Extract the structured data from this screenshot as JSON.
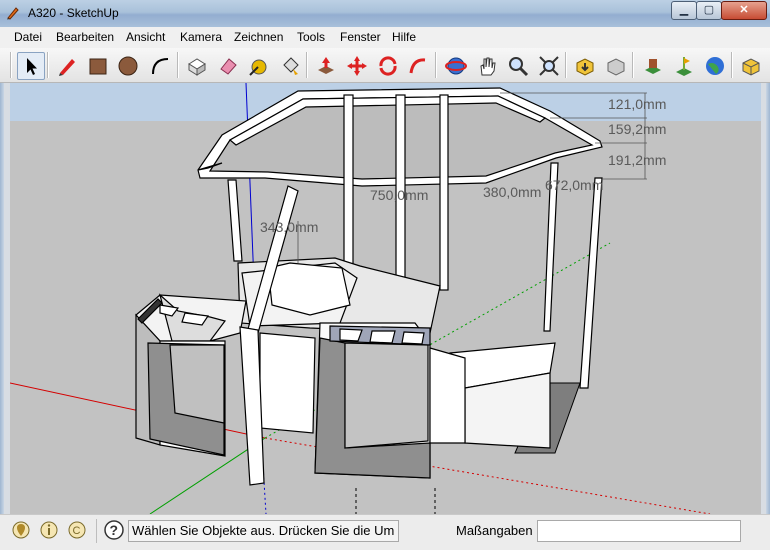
{
  "window": {
    "title": "A320 - SketchUp",
    "min_label": "▁",
    "max_label": "▢",
    "close_label": "✕"
  },
  "menu": {
    "items": [
      "Datei",
      "Bearbeiten",
      "Ansicht",
      "Kamera",
      "Zeichnen",
      "Tools",
      "Fenster",
      "Hilfe"
    ]
  },
  "toolbar": {
    "tools": [
      "select-icon",
      "pencil-icon",
      "rectangle-icon",
      "circle-icon",
      "arc-icon",
      "make-component-icon",
      "eraser-icon",
      "tape-measure-icon",
      "paint-bucket-icon",
      "push-pull-icon",
      "move-icon",
      "rotate-icon",
      "follow-me-icon",
      "orbit-icon",
      "pan-icon",
      "zoom-icon",
      "zoom-extents-icon",
      "get-models-icon",
      "share-model-icon",
      "place-model-icon",
      "add-location-icon",
      "google-earth-icon",
      "components-icon"
    ]
  },
  "dimensions": {
    "d1": "121,0mm",
    "d2": "159,2mm",
    "d3": "191,2mm",
    "d4": "750,0mm",
    "d5": "380,0mm",
    "d6": "672,0mm",
    "d7": "343,0mm"
  },
  "status": {
    "icons": [
      "geo-location-icon",
      "credits-icon",
      "copyright-icon",
      "help-icon"
    ],
    "message": "Wählen Sie Objekte aus. Drücken Sie die Um",
    "vcb_label": "Maßangaben",
    "vcb_value": ""
  },
  "colors": {
    "sky": "#bcd0e6",
    "ground": "#c2c2c2",
    "axis_red": "#d40000",
    "axis_green": "#00a000",
    "axis_blue": "#0000d0",
    "face": "#ffffff",
    "face_back": "#a9a9b3",
    "shadow_face": "#8f8f8f"
  }
}
